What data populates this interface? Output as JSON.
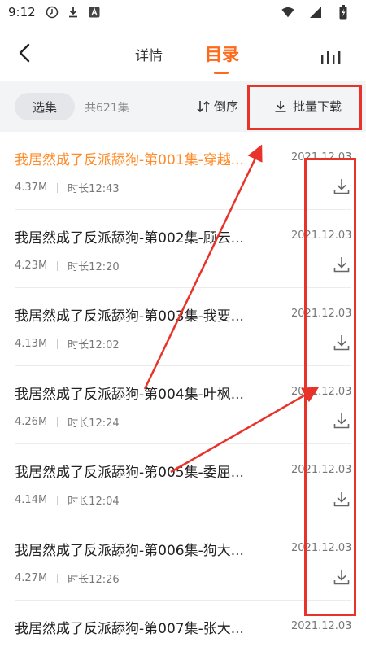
{
  "status_bar": {
    "time": "9:12",
    "icons": [
      "media-icon",
      "download-icon",
      "a-badge-icon",
      "wifi-icon",
      "signal-icon",
      "battery-icon"
    ]
  },
  "header": {
    "tabs": [
      {
        "label": "详情",
        "active": false
      },
      {
        "label": "目录",
        "active": true
      }
    ],
    "accent_color": "#ff6a1a"
  },
  "toolbar": {
    "select_label": "选集",
    "total_label": "共621集",
    "reverse_label": "倒序",
    "batch_download_label": "批量下载"
  },
  "episodes": [
    {
      "title": "我居然成了反派舔狗-第001集-穿越...",
      "size": "4.37M",
      "duration": "时长12:43",
      "date": "2021.12.03",
      "active": true
    },
    {
      "title": "我居然成了反派舔狗-第002集-顾云...",
      "size": "4.23M",
      "duration": "时长12:20",
      "date": "2021.12.03",
      "active": false
    },
    {
      "title": "我居然成了反派舔狗-第003集-我要...",
      "size": "4.13M",
      "duration": "时长12:02",
      "date": "2021.12.03",
      "active": false
    },
    {
      "title": "我居然成了反派舔狗-第004集-叶枫...",
      "size": "4.26M",
      "duration": "时长12:24",
      "date": "2021.12.03",
      "active": false
    },
    {
      "title": "我居然成了反派舔狗-第005集-委屈...",
      "size": "4.14M",
      "duration": "时长12:04",
      "date": "2021.12.03",
      "active": false
    },
    {
      "title": "我居然成了反派舔狗-第006集-狗大...",
      "size": "4.27M",
      "duration": "时长12:26",
      "date": "2021.12.03",
      "active": false
    },
    {
      "title": "我居然成了反派舔狗-第007集-张大...",
      "size": "",
      "duration": "",
      "date": "2021.12.03",
      "active": false
    }
  ],
  "annotation_color": "#e8332a"
}
